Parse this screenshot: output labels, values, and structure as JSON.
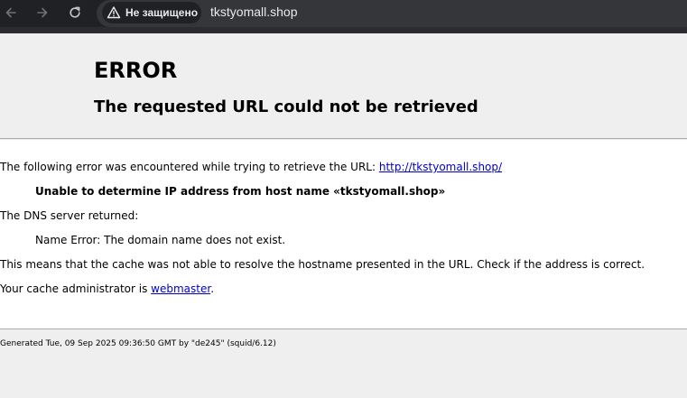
{
  "browser": {
    "security_label": "Не защищено",
    "url": "tkstyomall.shop"
  },
  "error": {
    "title": "ERROR",
    "subtitle": "The requested URL could not be retrieved",
    "intro_text": "The following error was encountered while trying to retrieve the URL: ",
    "intro_link": "http://tkstyomall.shop/",
    "error_detail": "Unable to determine IP address from host name «tkstyomall.shop»",
    "dns_label": "The DNS server returned:",
    "dns_message": "Name Error: The domain name does not exist.",
    "explanation": "This means that the cache was not able to resolve the hostname presented in the URL. Check if the address is correct.",
    "admin_text": "Your cache administrator is ",
    "admin_link": "webmaster",
    "admin_suffix": "."
  },
  "footer": {
    "generated": "Generated Tue, 09 Sep 2025 09:36:50 GMT by \"de245\" (squid/6.12)"
  }
}
